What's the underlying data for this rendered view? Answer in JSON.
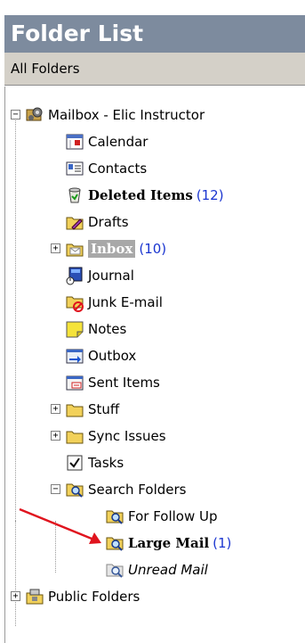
{
  "header": {
    "title": "Folder List"
  },
  "subheader": {
    "label": "All Folders"
  },
  "tree": {
    "mailbox": {
      "label": "Mailbox - Elic Instructor",
      "expander": "−"
    },
    "calendar": {
      "label": "Calendar"
    },
    "contacts": {
      "label": "Contacts"
    },
    "deleted": {
      "label": "Deleted Items",
      "count": "(12)"
    },
    "drafts": {
      "label": "Drafts"
    },
    "inbox": {
      "label": "Inbox",
      "count": "(10)",
      "expander": "+"
    },
    "journal": {
      "label": "Journal"
    },
    "junk": {
      "label": "Junk E-mail"
    },
    "notes": {
      "label": "Notes"
    },
    "outbox": {
      "label": "Outbox"
    },
    "sent": {
      "label": "Sent Items"
    },
    "stuff": {
      "label": "Stuff",
      "expander": "+"
    },
    "sync": {
      "label": "Sync Issues",
      "expander": "+"
    },
    "tasks": {
      "label": "Tasks"
    },
    "search": {
      "label": "Search Folders",
      "expander": "−"
    },
    "followup": {
      "label": "For Follow Up"
    },
    "largemail": {
      "label": "Large Mail",
      "count": "(1)"
    },
    "unread": {
      "label": "Unread Mail"
    },
    "public": {
      "label": "Public Folders",
      "expander": "+"
    }
  },
  "colors": {
    "header_bg": "#7d8b9e",
    "count_blue": "#1a35d0",
    "arrow_red": "#e0141e",
    "folder_yellow": "#f2d15a"
  }
}
